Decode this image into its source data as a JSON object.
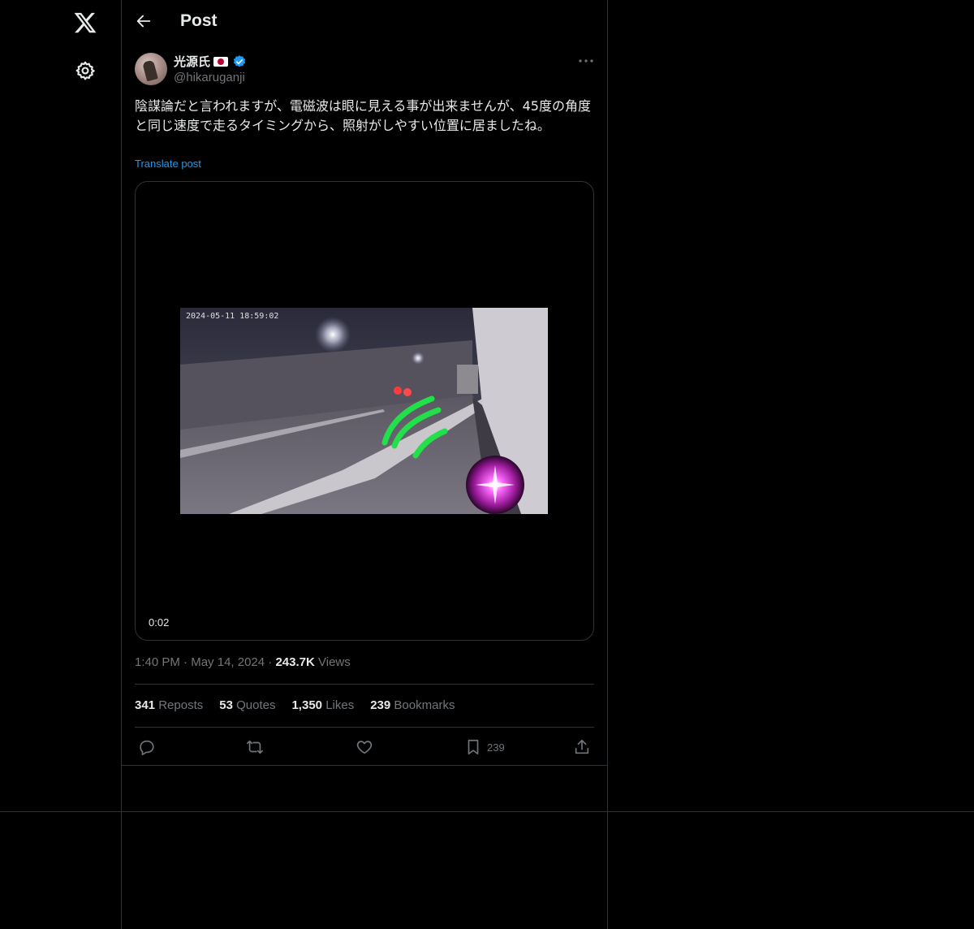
{
  "nav": {
    "logo_icon": "x-logo-icon",
    "settings_icon": "gear-icon"
  },
  "header": {
    "title": "Post"
  },
  "post": {
    "author_name": "光源氏",
    "author_handle": "@hikaruganji",
    "text": "陰謀論だと言われますが、電磁波は眼に見える事が出来ませんが、45度の角度と同じ速度で走るタイミングから、照射がしやすい位置に居ましたね。",
    "translate_label": "Translate post",
    "video_timestamp_overlay": "2024-05-11 18:59:02",
    "video_time": "0:02",
    "time": "1:40 PM",
    "date": "May 14, 2024",
    "views_count": "243.7K",
    "views_label": "Views"
  },
  "stats": {
    "reposts_count": "341",
    "reposts_label": "Reposts",
    "quotes_count": "53",
    "quotes_label": "Quotes",
    "likes_count": "1,350",
    "likes_label": "Likes",
    "bookmarks_count": "239",
    "bookmarks_label": "Bookmarks"
  },
  "actions": {
    "bookmark_count": "239"
  },
  "colors": {
    "background": "#000000",
    "link": "#1d9bf0",
    "muted": "#71767b",
    "border": "#2f3336",
    "text": "#e7e9ea"
  }
}
